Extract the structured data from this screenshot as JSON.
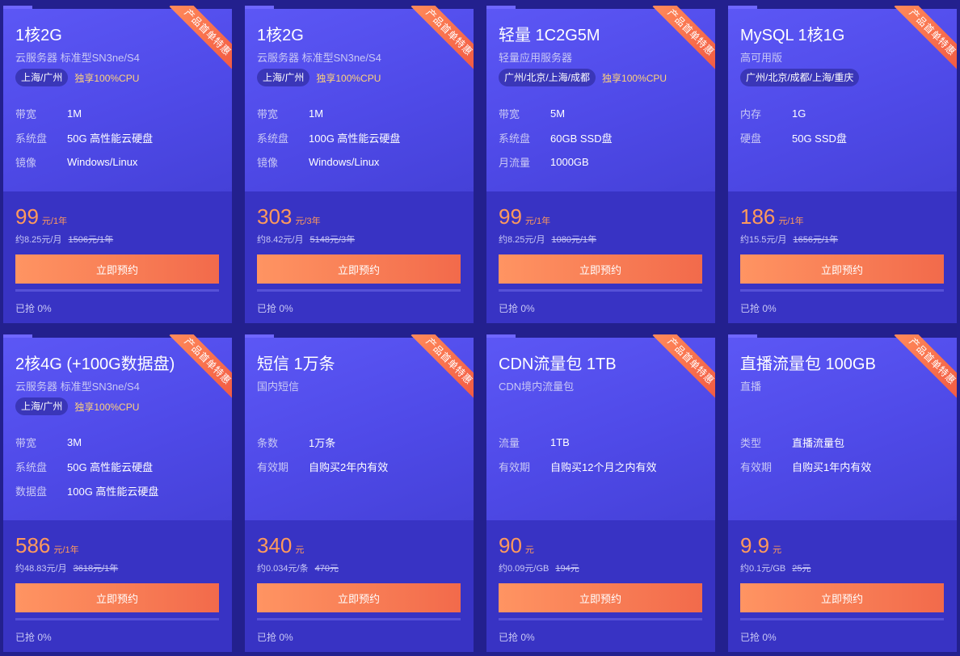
{
  "ribbon_label": "产品首单特惠",
  "buy_label": "立即预约",
  "cards": [
    {
      "title": "1核2G",
      "subtitle": "云服务器 标准型SN3ne/S4",
      "region": "上海/广州",
      "cpu": "独享100%CPU",
      "specs": [
        {
          "k": "带宽",
          "v": "1M"
        },
        {
          "k": "系统盘",
          "v": "50G 高性能云硬盘"
        },
        {
          "k": "镜像",
          "v": "Windows/Linux"
        }
      ],
      "price": "99",
      "price_unit": "元/1年",
      "monthly": "约8.25元/月",
      "original": "1506元/1年",
      "sold": "已抢 0%",
      "sold_fraction": 0
    },
    {
      "title": "1核2G",
      "subtitle": "云服务器 标准型SN3ne/S4",
      "region": "上海/广州",
      "cpu": "独享100%CPU",
      "specs": [
        {
          "k": "带宽",
          "v": "1M"
        },
        {
          "k": "系统盘",
          "v": "100G 高性能云硬盘"
        },
        {
          "k": "镜像",
          "v": "Windows/Linux"
        }
      ],
      "price": "303",
      "price_unit": "元/3年",
      "monthly": "约8.42元/月",
      "original": "5148元/3年",
      "sold": "已抢 0%",
      "sold_fraction": 0
    },
    {
      "title": "轻量 1C2G5M",
      "subtitle": "轻量应用服务器",
      "region": "广州/北京/上海/成都",
      "cpu": "独享100%CPU",
      "specs": [
        {
          "k": "带宽",
          "v": "5M"
        },
        {
          "k": "系统盘",
          "v": "60GB SSD盘"
        },
        {
          "k": "月流量",
          "v": "1000GB"
        }
      ],
      "price": "99",
      "price_unit": "元/1年",
      "monthly": "约8.25元/月",
      "original": "1080元/1年",
      "sold": "已抢 0%",
      "sold_fraction": 0
    },
    {
      "title": "MySQL 1核1G",
      "subtitle": "高可用版",
      "region": "广州/北京/成都/上海/重庆",
      "cpu": "",
      "specs": [
        {
          "k": "内存",
          "v": "1G"
        },
        {
          "k": "硬盘",
          "v": "50G SSD盘"
        }
      ],
      "price": "186",
      "price_unit": "元/1年",
      "monthly": "约15.5元/月",
      "original": "1656元/1年",
      "sold": "已抢 0%",
      "sold_fraction": 0
    },
    {
      "title": "2核4G (+100G数据盘)",
      "subtitle": "云服务器 标准型SN3ne/S4",
      "region": "上海/广州",
      "cpu": "独享100%CPU",
      "specs": [
        {
          "k": "带宽",
          "v": "3M"
        },
        {
          "k": "系统盘",
          "v": "50G 高性能云硬盘"
        },
        {
          "k": "数据盘",
          "v": "100G 高性能云硬盘"
        }
      ],
      "price": "586",
      "price_unit": "元/1年",
      "monthly": "约48.83元/月",
      "original": "3618元/1年",
      "sold": "已抢 0%",
      "sold_fraction": 0
    },
    {
      "title": "短信 1万条",
      "subtitle": "国内短信",
      "region": "",
      "cpu": "",
      "specs": [
        {
          "k": "条数",
          "v": "1万条"
        },
        {
          "k": "有效期",
          "v": "自购买2年内有效"
        }
      ],
      "price": "340",
      "price_unit": "元",
      "monthly": "约0.034元/条",
      "original": "470元",
      "sold": "已抢 0%",
      "sold_fraction": 0
    },
    {
      "title": "CDN流量包 1TB",
      "subtitle": "CDN境内流量包",
      "region": "",
      "cpu": "",
      "specs": [
        {
          "k": "流量",
          "v": "1TB"
        },
        {
          "k": "有效期",
          "v": "自购买12个月之内有效"
        }
      ],
      "price": "90",
      "price_unit": "元",
      "monthly": "约0.09元/GB",
      "original": "194元",
      "sold": "已抢 0%",
      "sold_fraction": 0
    },
    {
      "title": "直播流量包 100GB",
      "subtitle": "直播",
      "region": "",
      "cpu": "",
      "specs": [
        {
          "k": "类型",
          "v": "直播流量包"
        },
        {
          "k": "有效期",
          "v": "自购买1年内有效"
        }
      ],
      "price": "9.9",
      "price_unit": "元",
      "monthly": "约0.1元/GB",
      "original": "25元",
      "sold": "已抢 0%",
      "sold_fraction": 0
    }
  ]
}
